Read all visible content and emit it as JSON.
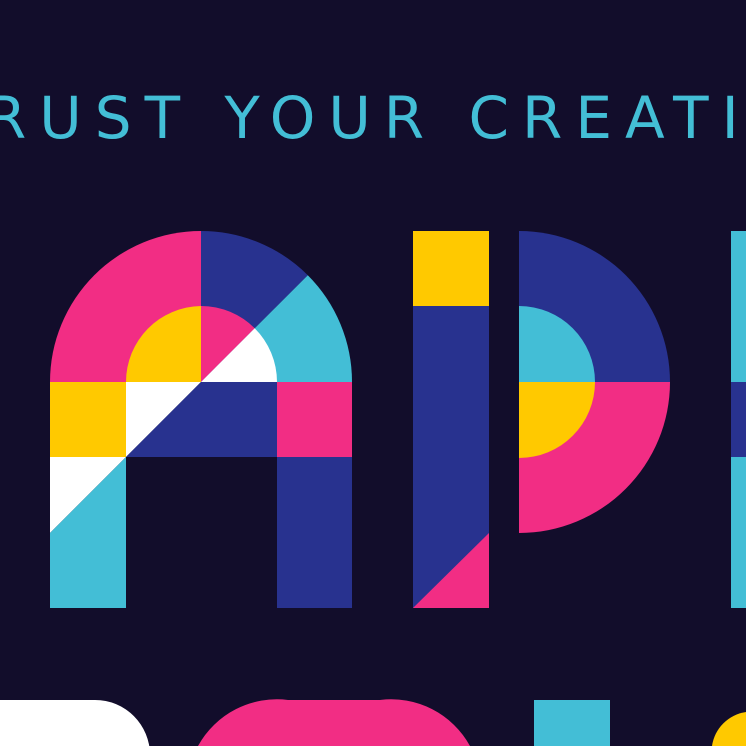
{
  "tagline": "RUST YOUR CREATI",
  "palette": {
    "background": "#120d2b",
    "pink": "#f22d84",
    "navy": "#28328f",
    "cyan": "#43bed6",
    "yellow": "#ffc900",
    "white": "#ffffff"
  }
}
